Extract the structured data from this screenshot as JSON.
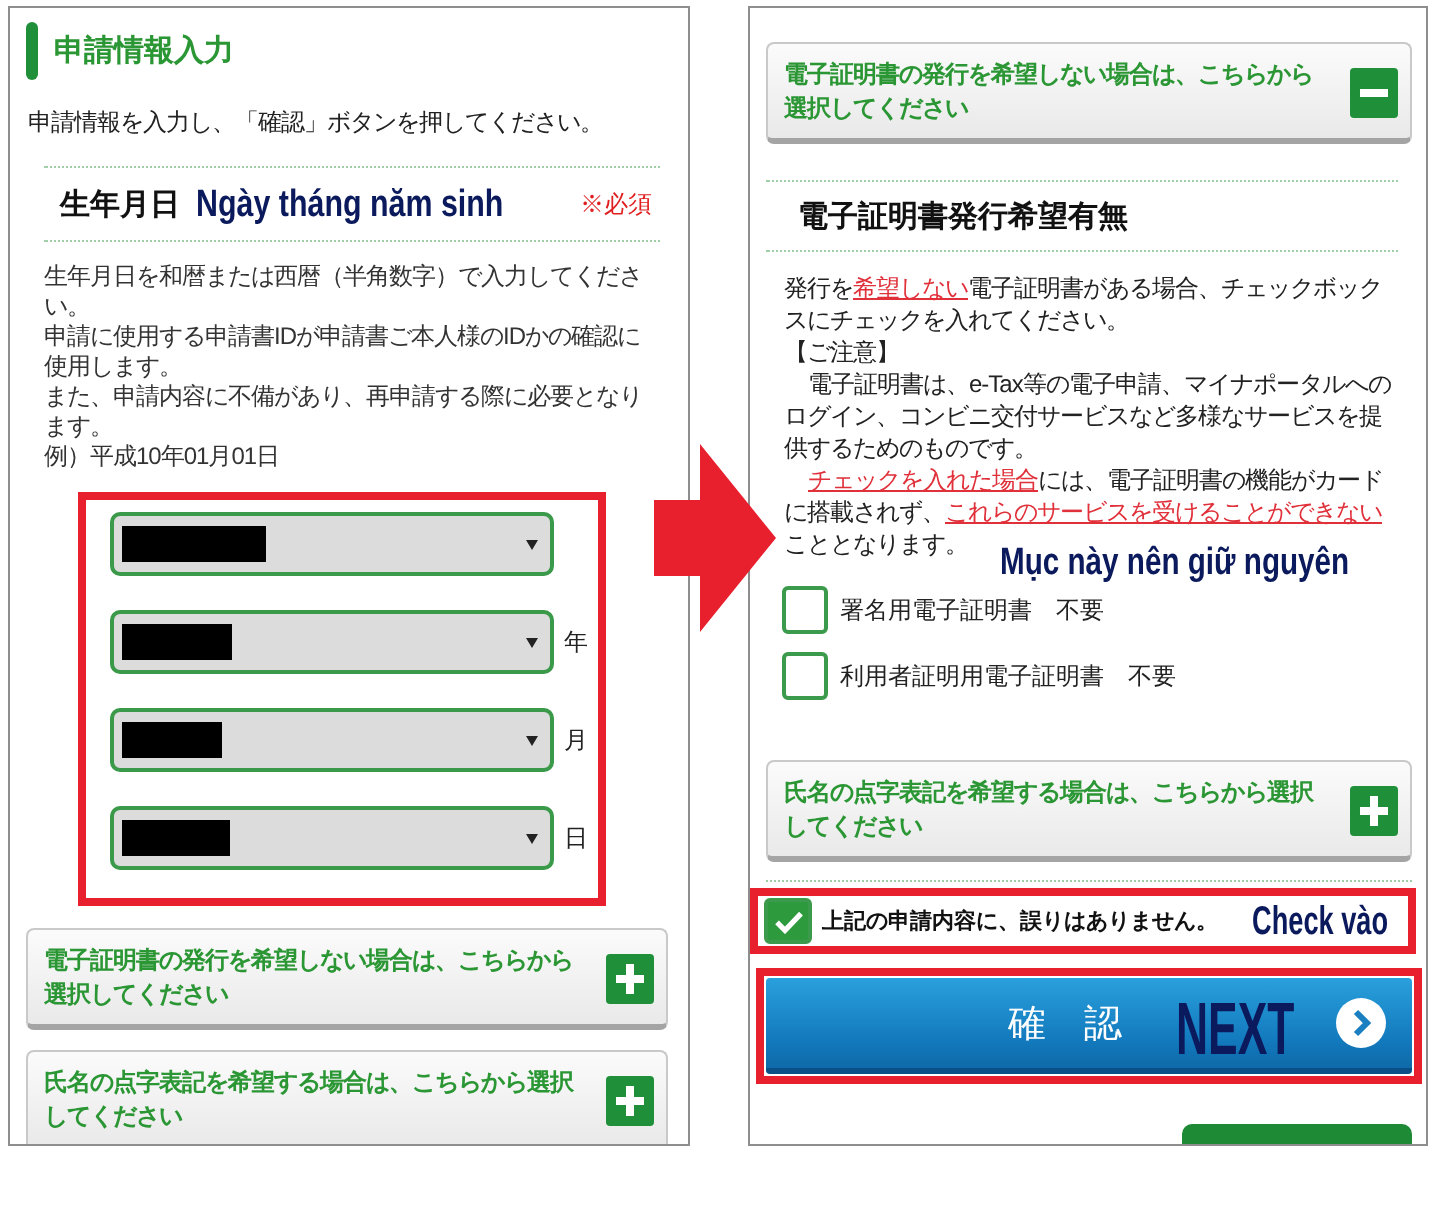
{
  "left_screen": {
    "section_title": "申請情報入力",
    "instruction": "申請情報を入力し、「確認」ボタンを押してください。",
    "birth_date": {
      "label": "生年月日",
      "annotation": "Ngày tháng năm sinh",
      "required_mark": "※必須",
      "help": [
        "生年月日を和暦または西暦（半角数字）で入力してください。",
        "申請に使用する申請書IDが申請書ご本人様のIDかの確認に使用します。",
        "また、申請内容に不備があり、再申請する際に必要となります。",
        "例）平成10年01月01日"
      ],
      "highlighted": true,
      "selects": [
        {
          "redacted": true
        },
        {
          "redacted": true,
          "suffix": "年"
        },
        {
          "redacted": true,
          "suffix": "月"
        },
        {
          "redacted": true,
          "suffix": "日"
        }
      ]
    },
    "accordions": [
      {
        "label": "電子証明書の発行を希望しない場合は、こちらから選択してください",
        "expanded": false
      },
      {
        "label": "氏名の点字表記を希望する場合は、こちらから選択してください",
        "expanded": false
      }
    ]
  },
  "right_screen": {
    "accordions": [
      {
        "label": "電子証明書の発行を希望しない場合は、こちらから選択してください",
        "expanded": true,
        "content": {
          "heading": "電子証明書発行希望有無",
          "paragraphs": [
            {
              "indent": false,
              "segments": [
                {
                  "text": "発行を",
                  "emphasis": false
                },
                {
                  "text": "希望しない",
                  "emphasis": true
                },
                {
                  "text": "電子証明書がある場合、チェックボックスにチェックを入れてください。",
                  "emphasis": false
                }
              ]
            },
            {
              "indent": false,
              "segments": [
                {
                  "text": "【ご注意】",
                  "emphasis": false
                }
              ]
            },
            {
              "indent": true,
              "segments": [
                {
                  "text": "電子証明書は、e-Tax等の電子申請、マイナポータルへのログイン、コンビニ交付サービスなど多様なサービスを提供するためのものです。",
                  "emphasis": false
                }
              ]
            },
            {
              "indent": true,
              "segments": [
                {
                  "text": "チェックを入れた場合",
                  "emphasis": true
                },
                {
                  "text": "には、電子証明書の機能がカードに搭載されず、",
                  "emphasis": false
                },
                {
                  "text": "これらのサービスを受けることができない",
                  "emphasis": true
                },
                {
                  "text": "こととなります。",
                  "emphasis": false
                }
              ]
            }
          ],
          "annotation": "Mục này nên giữ nguyên",
          "options": [
            {
              "label": "署名用電子証明書　不要",
              "checked": false
            },
            {
              "label": "利用者証明用電子証明書　不要",
              "checked": false
            }
          ]
        }
      },
      {
        "label": "氏名の点字表記を希望する場合は、こちらから選択してください",
        "expanded": false
      }
    ],
    "agreement": {
      "label": "上記の申請内容に、誤りはありません。",
      "checked": true,
      "annotation": "Check vào",
      "highlighted": true
    },
    "confirm_button": {
      "label": "確　認",
      "annotation": "NEXT",
      "highlighted": true
    }
  }
}
